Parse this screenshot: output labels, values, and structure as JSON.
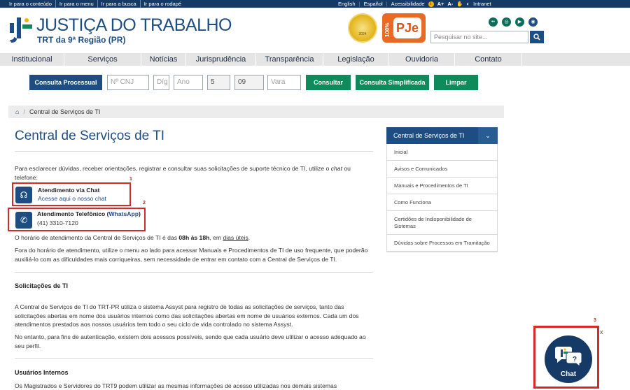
{
  "topbar": {
    "skip_links": [
      "Ir para o conteúdo",
      "Ir para o menu",
      "Ir para a busca",
      "Ir para o rodapé"
    ],
    "lang_en": "English",
    "lang_es": "Español",
    "accessibility": "Acessibilidade",
    "font_plus": "A+",
    "font_minus": "A-",
    "intranet": "Intranet"
  },
  "header": {
    "title": "JUSTIÇA DO TRABALHO",
    "subtitle": "TRT da 9ª Região (PR)",
    "seal_text": "2024",
    "pje_pct": "100%",
    "pje_label": "PJe",
    "search_placeholder": "Pesquisar no site..."
  },
  "nav": [
    {
      "label": "Institucional",
      "w": 92
    },
    {
      "label": "Serviços",
      "w": 110
    },
    {
      "label": "Notícias",
      "w": 64
    },
    {
      "label": "Jurisprudência",
      "w": 100
    },
    {
      "label": "Transparência",
      "w": 96
    },
    {
      "label": "Legislação",
      "w": 94
    },
    {
      "label": "Ouvidoria",
      "w": 94
    },
    {
      "label": "Contato",
      "w": 96
    }
  ],
  "consulta": {
    "button": "Consulta Processual",
    "cnj_placeholder": "Nº CNJ",
    "dig_placeholder": "Díg",
    "ano_placeholder": "Ano",
    "field4_value": "5",
    "field5_value": "09",
    "vara_placeholder": "Vara",
    "consultar": "Consultar",
    "simplificada": "Consulta Simplificada",
    "limpar": "Limpar"
  },
  "breadcrumb": {
    "current": "Central de Serviços de TI"
  },
  "main": {
    "title": "Central de Serviços de TI",
    "intro_1": "Para esclarecer dúvidas, receber orientações, registrar e consultar suas solicitações de suporte técnico de TI, utilize o ",
    "intro_chat": "chat",
    "intro_2": " ou",
    "intro_3": "telefone:",
    "chat_title": "Atendimento via Chat",
    "chat_link": "Acesse aqui o nosso chat",
    "phone_title": "Atendimento Telefônico (",
    "phone_wa": "WhatsApp",
    "phone_close": ")",
    "phone_number": "(41) 3310-7120",
    "hours_1": "O horário de atendimento da Central de Serviços de TI é das ",
    "hours_bold": "08h às 18h",
    "hours_2": ", em ",
    "hours_link": "dias úteis",
    "hours_3": ".",
    "outside_1": "Fora do horário de atendimento, utilize o menu ao lado para acessar Manuais e Procedimentos de TI de uso frequente, que poderão",
    "outside_2": "auxiliá-lo com as dificuldades mais corriqueiras, sem necessidade de entrar em contato com a Central de Serviços de TI.",
    "sol_head": "Solicitações de TI",
    "sol_1": "A Central de Serviços de TI do TRT-PR utiliza o sistema Assyst para registro de todas as solicitações de serviços, tanto das",
    "sol_2": "solicitações abertas em nome dos usuários internos como das solicitações abertas em nome de usuários externos. Cada um dos",
    "sol_3": "atendimentos prestados aos nossos usuários tem todo o seu ciclo de vida controlado no sistema Assyst.",
    "auth_1": "No entanto, para fins de autenticação, existem dois acessos possíveis, sendo que cada usuário deve utilizar o acesso adequado ao",
    "auth_2": "seu perfil.",
    "users_head": "Usuários Internos",
    "users_1": "Os Magistrados e Servidores do TRT9 podem utilizar as mesmas informações de acesso utilizadas nos demais sistemas"
  },
  "annotations": {
    "n1": "1",
    "n2": "2",
    "n3": "3"
  },
  "sidebar": {
    "header": "Central de Serviços de TI",
    "items": [
      {
        "label": "Inicial",
        "h": 24
      },
      {
        "label": "Avisos e Comunicados",
        "h": 24
      },
      {
        "label": "Manuais e Procedimentos de TI",
        "h": 24
      },
      {
        "label": "Como Funciona",
        "h": 24
      },
      {
        "label": "Certidões de Indisponibilidade de Sistemas",
        "h": 34
      },
      {
        "label": "Dúvidas sobre Processos em Tramitação",
        "h": 24
      }
    ]
  },
  "chat_widget": {
    "label": "Chat",
    "close": "x"
  }
}
